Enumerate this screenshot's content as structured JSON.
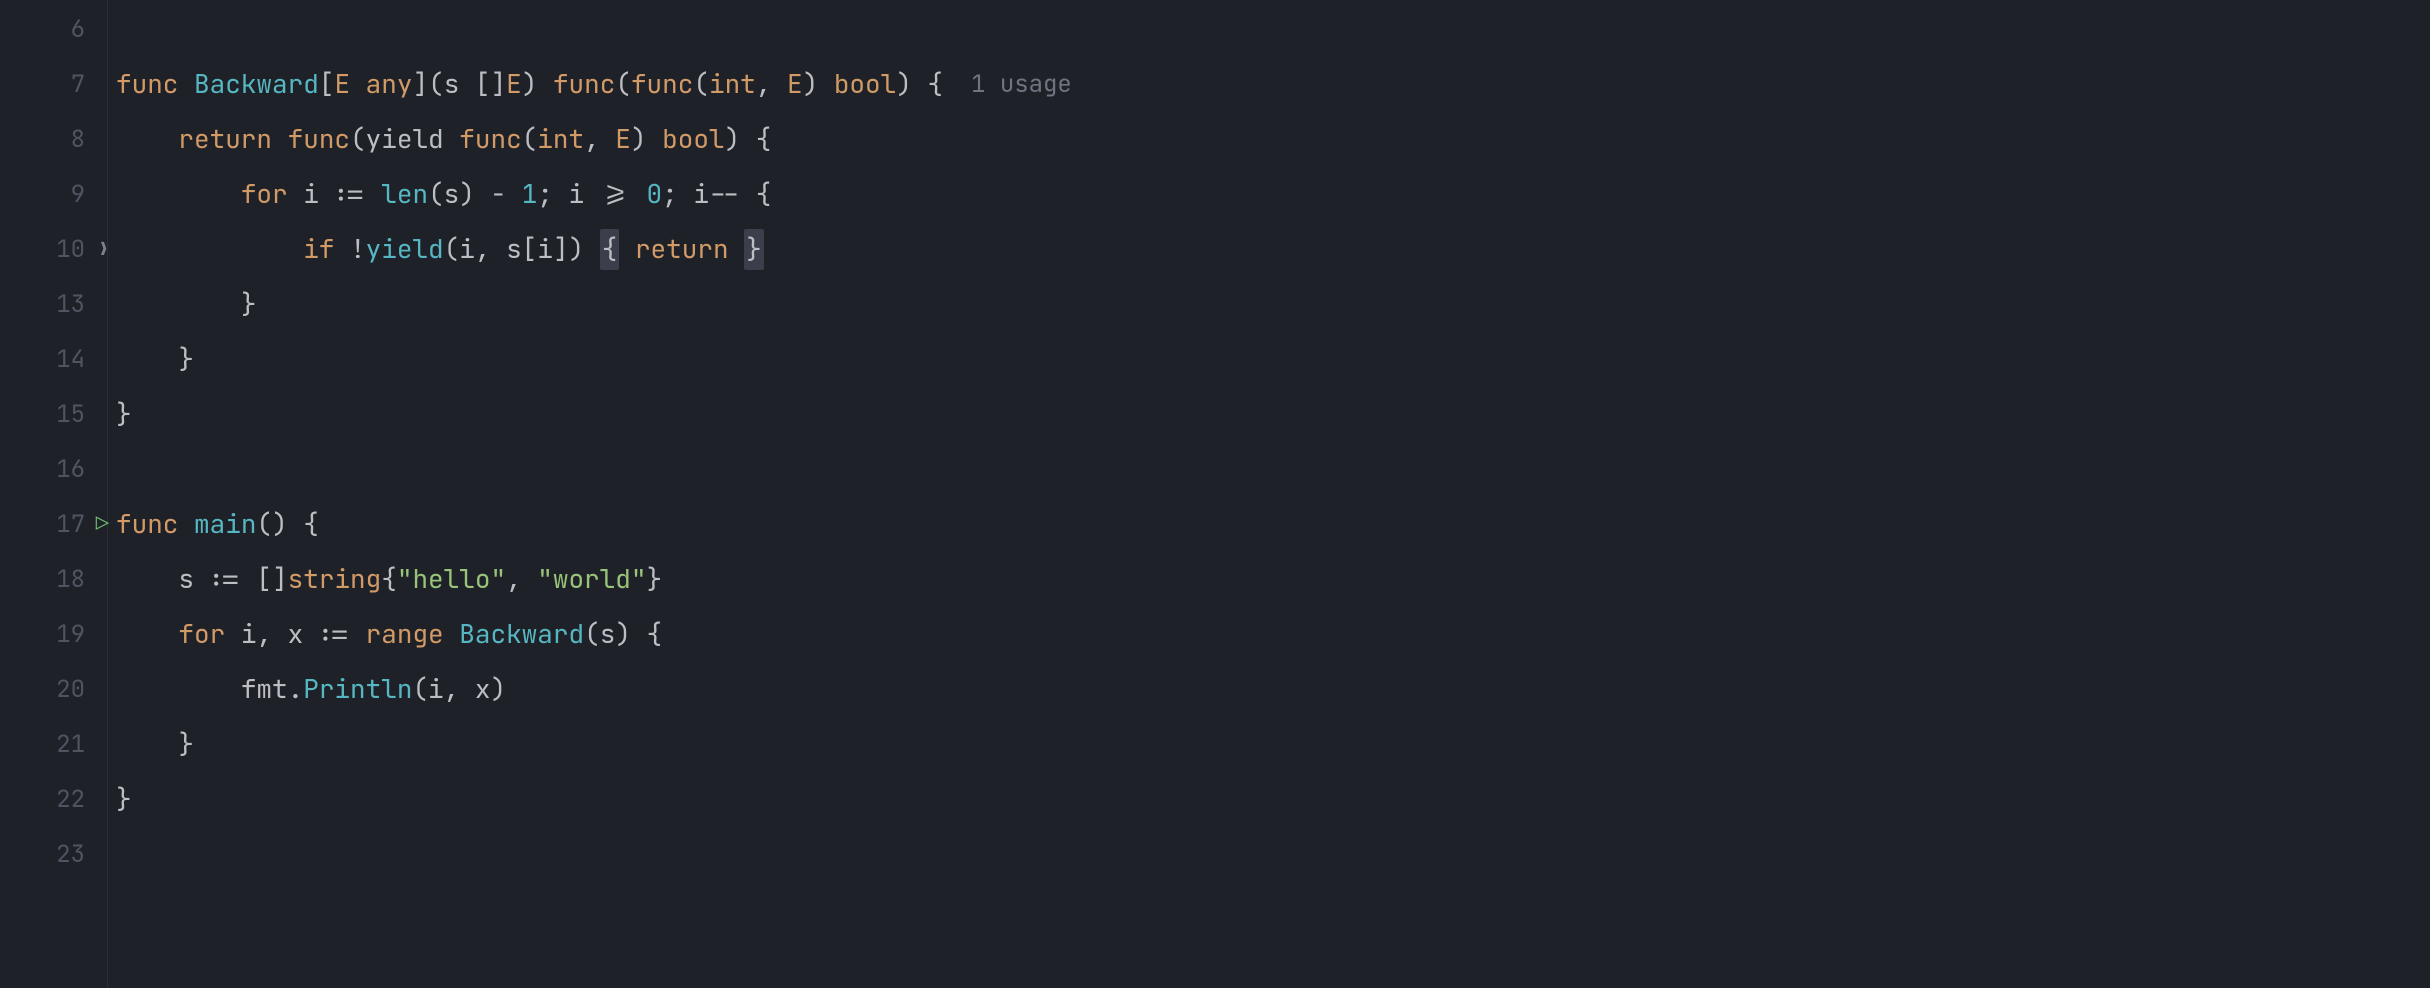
{
  "gutter": {
    "lines": [
      "6",
      "7",
      "8",
      "9",
      "10",
      "13",
      "14",
      "15",
      "16",
      "17",
      "18",
      "19",
      "20",
      "21",
      "22",
      "23"
    ],
    "fold_at_index": 4,
    "run_at_index": 9
  },
  "usage_hint": "1 usage",
  "code": {
    "l7": {
      "func": "func",
      "name": "Backward",
      "lb": "[",
      "E": "E",
      "any": "any",
      "rb": "]",
      "lp": "(",
      "s": "s",
      "sp": " ",
      "br": "[]",
      "E2": "E",
      "rp": ")",
      "func2": "func",
      "lp2": "(",
      "func3": "func",
      "lp3": "(",
      "int": "int",
      "comma": ", ",
      "E3": "E",
      "rp3": ")",
      "bool": "bool",
      "rp2": ")",
      "lbrace": " {"
    },
    "l8": {
      "indent": "    ",
      "return": "return",
      "func": "func",
      "lp": "(",
      "yield": "yield",
      "func2": "func",
      "lp2": "(",
      "int": "int",
      "comma": ", ",
      "E": "E",
      "rp2": ")",
      "bool": "bool",
      "rp": ")",
      "lbrace": " {"
    },
    "l9": {
      "indent": "        ",
      "for": "for",
      "sp": " ",
      "i": "i",
      "assign": " := ",
      "len": "len",
      "lp": "(",
      "s": "s",
      "rp": ")",
      "minus": " - ",
      "one": "1",
      "semi1": "; ",
      "i2": "i",
      "gte": " >= ",
      "zero": "0",
      "semi2": "; ",
      "i3": "i",
      "dec": "--",
      "lbrace": " {"
    },
    "l10": {
      "indent": "            ",
      "if": "if",
      "sp": " ",
      "neg": "!",
      "yield": "yield",
      "lp": "(",
      "i": "i",
      "comma": ", ",
      "s": "s",
      "lb": "[",
      "i2": "i",
      "rb": "]",
      "rp": ")",
      "sp2": " ",
      "hl_open": "{",
      "return": "return",
      "hl_close": "}"
    },
    "l13": {
      "indent": "        ",
      "rbrace": "}"
    },
    "l14": {
      "indent": "    ",
      "rbrace": "}"
    },
    "l15": {
      "rbrace": "}"
    },
    "l17": {
      "func": "func",
      "name": "main",
      "parens": "()",
      "lbrace": " {"
    },
    "l18": {
      "indent": "    ",
      "s": "s",
      "assign": " := ",
      "br": "[]",
      "string": "string",
      "lb": "{",
      "hello": "\"hello\"",
      "comma": ", ",
      "world": "\"world\"",
      "rb": "}"
    },
    "l19": {
      "indent": "    ",
      "for": "for",
      "sp": " ",
      "i": "i",
      "comma": ", ",
      "x": "x",
      "assign": " := ",
      "range": "range",
      "sp2": " ",
      "Backward": "Backward",
      "lp": "(",
      "s": "s",
      "rp": ")",
      "lbrace": " {"
    },
    "l20": {
      "indent": "        ",
      "fmt": "fmt",
      "dot": ".",
      "Println": "Println",
      "lp": "(",
      "i": "i",
      "comma": ", ",
      "x": "x",
      "rp": ")"
    },
    "l21": {
      "indent": "    ",
      "rbrace": "}"
    },
    "l22": {
      "rbrace": "}"
    }
  }
}
